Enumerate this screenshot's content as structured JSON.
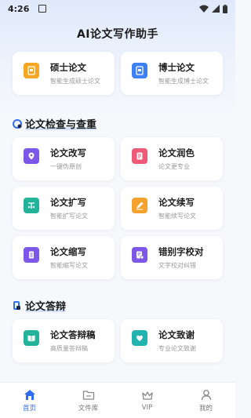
{
  "status_bar": {
    "time": "4:26"
  },
  "header": {
    "title": "AI论文写作助手"
  },
  "top_cards": [
    {
      "title": "硕士论文",
      "subtitle": "智能生成硕士论文",
      "icon": "master-thesis-icon",
      "color": "#f5a623"
    },
    {
      "title": "博士论文",
      "subtitle": "智能生成博士论文",
      "icon": "doctor-thesis-icon",
      "color": "#3d7ff5"
    }
  ],
  "section1": {
    "title": "论文检查与查重",
    "cards": [
      {
        "title": "论文改写",
        "subtitle": "一键伪原创",
        "icon": "rewrite-icon",
        "color": "#7d57e8"
      },
      {
        "title": "论文润色",
        "subtitle": "论文更专业",
        "icon": "polish-icon",
        "color": "#ef5a78"
      },
      {
        "title": "论文扩写",
        "subtitle": "智能扩写论文",
        "icon": "expand-icon",
        "color": "#22b39a"
      },
      {
        "title": "论文续写",
        "subtitle": "智能续写论文",
        "icon": "continue-icon",
        "color": "#f4a22d"
      },
      {
        "title": "论文缩写",
        "subtitle": "智能缩写论文",
        "icon": "abbreviate-icon",
        "color": "#7d57e8"
      },
      {
        "title": "错别字校对",
        "subtitle": "文字校对纠错",
        "icon": "proofread-icon",
        "color": "#7d57e8"
      }
    ]
  },
  "section2": {
    "title": "论文答辩",
    "cards": [
      {
        "title": "论文答辩稿",
        "subtitle": "高质量答辩稿",
        "icon": "defense-script-icon",
        "color": "#22b39a"
      },
      {
        "title": "论文致谢",
        "subtitle": "专业论文致谢",
        "icon": "acknowledgement-icon",
        "color": "#22b3b0"
      }
    ]
  },
  "tabbar": {
    "items": [
      {
        "label": "首页",
        "icon": "home-icon",
        "active": true
      },
      {
        "label": "文件库",
        "icon": "folder-icon",
        "active": false
      },
      {
        "label": "VIP",
        "icon": "crown-icon",
        "active": false
      },
      {
        "label": "我的",
        "icon": "user-icon",
        "active": false
      }
    ]
  },
  "colors": {
    "accent": "#2f6ef2",
    "background": "#f6f8fc"
  }
}
